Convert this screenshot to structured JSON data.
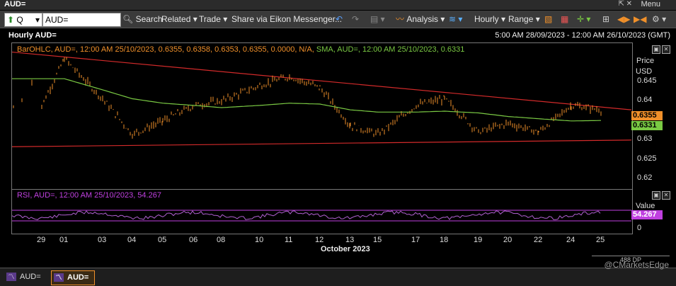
{
  "window": {
    "title": "AUD=",
    "menu_label": "Menu"
  },
  "toolbar": {
    "ric_prefix": "Q",
    "ric_value": "AUD=",
    "search_label": "Search",
    "related_label": "Related",
    "trade_label": "Trade",
    "share_label": "Share via Eikon Messenger...",
    "analysis_label": "Analysis",
    "interval_label": "Hourly",
    "range_label": "Range"
  },
  "chart": {
    "title": "Hourly AUD=",
    "date_range": "5:00 AM 28/09/2023 - 12:00 AM 26/10/2023 (GMT)",
    "legend_bar": "BarOHLC, AUD=, 12:00 AM 25/10/2023, 0.6355, 0.6358, 0.6353, 0.6355, 0.0000, N/A,",
    "legend_sma": "SMA, AUD=, 12:00 AM 25/10/2023, 0.6331",
    "price_axis_title": "Price",
    "price_axis_unit": "USD",
    "price_ticks": [
      "0.645",
      "0.64",
      "0.635",
      "0.63",
      "0.625",
      "0.62"
    ],
    "last_price_tag": "0.6355",
    "sma_tag": "0.6331",
    "rsi_legend": "RSI, AUD=, 12:00 AM 25/10/2023, 54.267",
    "rsi_axis_title": "Value",
    "rsi_tag": "54.267",
    "rsi_ticks": [
      "0"
    ],
    "date_labels": [
      "29",
      "01",
      "03",
      "04",
      "05",
      "06",
      "08",
      "10",
      "11",
      "12",
      "13",
      "15",
      "17",
      "18",
      "19",
      "20",
      "22",
      "24",
      "25"
    ],
    "month_label": "October 2023",
    "dp_label": "488 DP",
    "colors": {
      "price": "#f0902a",
      "sma": "#7ac943",
      "trend": "#d22a2a",
      "rsi": "#c040e0"
    }
  },
  "chart_data": {
    "type": "line",
    "title": "Hourly AUD=",
    "x": [
      "29",
      "01",
      "03",
      "04",
      "05",
      "06",
      "08",
      "10",
      "11",
      "12",
      "13",
      "15",
      "17",
      "18",
      "19",
      "20",
      "22",
      "24",
      "25"
    ],
    "series": [
      {
        "name": "BarOHLC, AUD=",
        "values": [
          0.6365,
          0.647,
          0.638,
          0.63,
          0.633,
          0.6365,
          0.6375,
          0.641,
          0.643,
          0.6405,
          0.632,
          0.63,
          0.6365,
          0.638,
          0.6305,
          0.6325,
          0.6305,
          0.6365,
          0.6355
        ]
      },
      {
        "name": "SMA, AUD=",
        "values": [
          0.6425,
          0.6425,
          0.64,
          0.638,
          0.637,
          0.6365,
          0.636,
          0.6365,
          0.637,
          0.6368,
          0.6355,
          0.635,
          0.635,
          0.6352,
          0.6348,
          0.634,
          0.6335,
          0.633,
          0.6331
        ]
      }
    ],
    "ylim": [
      0.618,
      0.6505
    ],
    "rsi": {
      "name": "RSI, AUD=",
      "last": 54.267
    }
  },
  "bottom": {
    "tab1_label": "AUD=",
    "tab2_label": "AUD=",
    "watermark": "@CMarketsEdge"
  }
}
